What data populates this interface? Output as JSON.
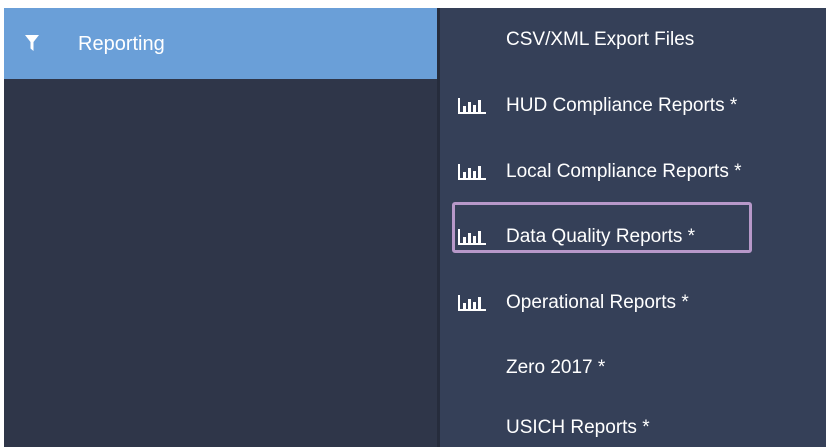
{
  "sidebar": {
    "active_item": {
      "label": "Reporting",
      "icon": "filter-icon"
    }
  },
  "submenu": {
    "items": [
      {
        "label": "CSV/XML Export Files",
        "icon": null
      },
      {
        "label": "HUD Compliance Reports *",
        "icon": "bar-chart-icon"
      },
      {
        "label": "Local Compliance Reports *",
        "icon": "bar-chart-icon"
      },
      {
        "label": "Data Quality Reports *",
        "icon": "bar-chart-icon",
        "highlighted": true
      },
      {
        "label": "Operational Reports *",
        "icon": "bar-chart-icon"
      },
      {
        "label": "Zero 2017 *",
        "icon": null
      },
      {
        "label": "USICH Reports *",
        "icon": null
      }
    ]
  },
  "colors": {
    "sidebar_bg": "#2f3649",
    "active_bg": "#6a9fd8",
    "submenu_bg": "#354058",
    "highlight_border": "#b798c9",
    "text": "#ffffff"
  }
}
